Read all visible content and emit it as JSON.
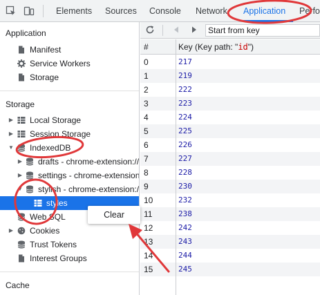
{
  "topbar": {
    "tabs": [
      {
        "label": "Elements"
      },
      {
        "label": "Sources"
      },
      {
        "label": "Console"
      },
      {
        "label": "Network"
      },
      {
        "label": "Application"
      },
      {
        "label": "Perfo"
      }
    ],
    "active_tab": "Application",
    "accent_color": "#1a73e8"
  },
  "sidebar": {
    "application_title": "Application",
    "application_items": [
      {
        "label": "Manifest",
        "icon": "document-icon"
      },
      {
        "label": "Service Workers",
        "icon": "gear-icon"
      },
      {
        "label": "Storage",
        "icon": "storage-icon"
      }
    ],
    "storage_title": "Storage",
    "storage_items": [
      {
        "label": "Local Storage",
        "icon": "grid-icon"
      },
      {
        "label": "Session Storage",
        "icon": "grid-icon"
      },
      {
        "label": "IndexedDB",
        "icon": "database-icon"
      },
      {
        "label": "drafts - chrome-extension://",
        "icon": "database-icon"
      },
      {
        "label": "settings - chrome-extension://",
        "icon": "database-icon"
      },
      {
        "label": "stylish - chrome-extension://",
        "icon": "database-icon"
      },
      {
        "label": "styles",
        "icon": "grid-icon",
        "selected": true
      },
      {
        "label": "Web SQL",
        "icon": "database-icon"
      },
      {
        "label": "Cookies",
        "icon": "cookie-icon"
      },
      {
        "label": "Trust Tokens",
        "icon": "database-icon"
      },
      {
        "label": "Interest Groups",
        "icon": "document-icon"
      }
    ],
    "cache_title": "Cache"
  },
  "data_toolbar": {
    "start_placeholder": "Start from key"
  },
  "table": {
    "col_index": "#",
    "col_key_prefix": "Key (Key path: \"",
    "col_key_path": "id",
    "col_key_suffix": "\")",
    "rows": [
      {
        "index": "0",
        "key": "217"
      },
      {
        "index": "1",
        "key": "219"
      },
      {
        "index": "2",
        "key": "222"
      },
      {
        "index": "3",
        "key": "223"
      },
      {
        "index": "4",
        "key": "224"
      },
      {
        "index": "5",
        "key": "225"
      },
      {
        "index": "6",
        "key": "226"
      },
      {
        "index": "7",
        "key": "227"
      },
      {
        "index": "8",
        "key": "228"
      },
      {
        "index": "9",
        "key": "230"
      },
      {
        "index": "10",
        "key": "232"
      },
      {
        "index": "11",
        "key": "238"
      },
      {
        "index": "12",
        "key": "242"
      },
      {
        "index": "13",
        "key": "243"
      },
      {
        "index": "14",
        "key": "244"
      },
      {
        "index": "15",
        "key": "245"
      }
    ]
  },
  "context_menu": {
    "items": [
      {
        "label": "Clear"
      }
    ]
  },
  "annotation_color": "#e0383a"
}
